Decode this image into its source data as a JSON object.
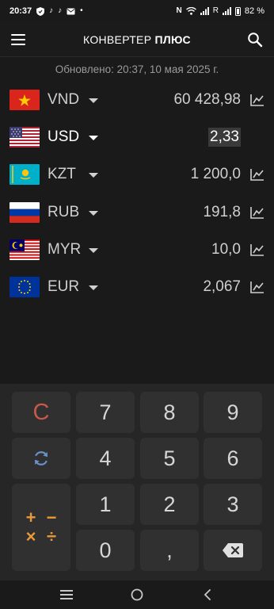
{
  "status_bar": {
    "time": "20:37",
    "battery_percent": "82 %",
    "signal_label": "R"
  },
  "app_bar": {
    "title_regular": "КОНВЕРТЕР ",
    "title_bold": "ПЛЮС"
  },
  "updated_text": "Обновлено: 20:37, 10 мая 2025 г.",
  "currencies": [
    {
      "code": "VND",
      "value": "60 428,98",
      "flag": "vietnam-flag",
      "active": false
    },
    {
      "code": "USD",
      "value": "2,33",
      "flag": "usa-flag",
      "active": true
    },
    {
      "code": "KZT",
      "value": "1 200,0",
      "flag": "kazakhstan-flag",
      "active": false
    },
    {
      "code": "RUB",
      "value": "191,8",
      "flag": "russia-flag",
      "active": false
    },
    {
      "code": "MYR",
      "value": "10,0",
      "flag": "malaysia-flag",
      "active": false
    },
    {
      "code": "EUR",
      "value": "2,067",
      "flag": "eu-flag",
      "active": false
    }
  ],
  "keypad": {
    "clear": "C",
    "digits": {
      "d0": "0",
      "d1": "1",
      "d2": "2",
      "d3": "3",
      "d4": "4",
      "d5": "5",
      "d6": "6",
      "d7": "7",
      "d8": "8",
      "d9": "9"
    },
    "decimal": ",",
    "ops": {
      "plus": "+",
      "minus": "−",
      "times": "×",
      "divide": "÷"
    }
  },
  "colors": {
    "background": "#1a1a1a",
    "keypad_background": "#262626",
    "key": "#303030",
    "clear": "#c9574a",
    "ops": "#e89a3a",
    "refresh": "#6b8fc9"
  }
}
